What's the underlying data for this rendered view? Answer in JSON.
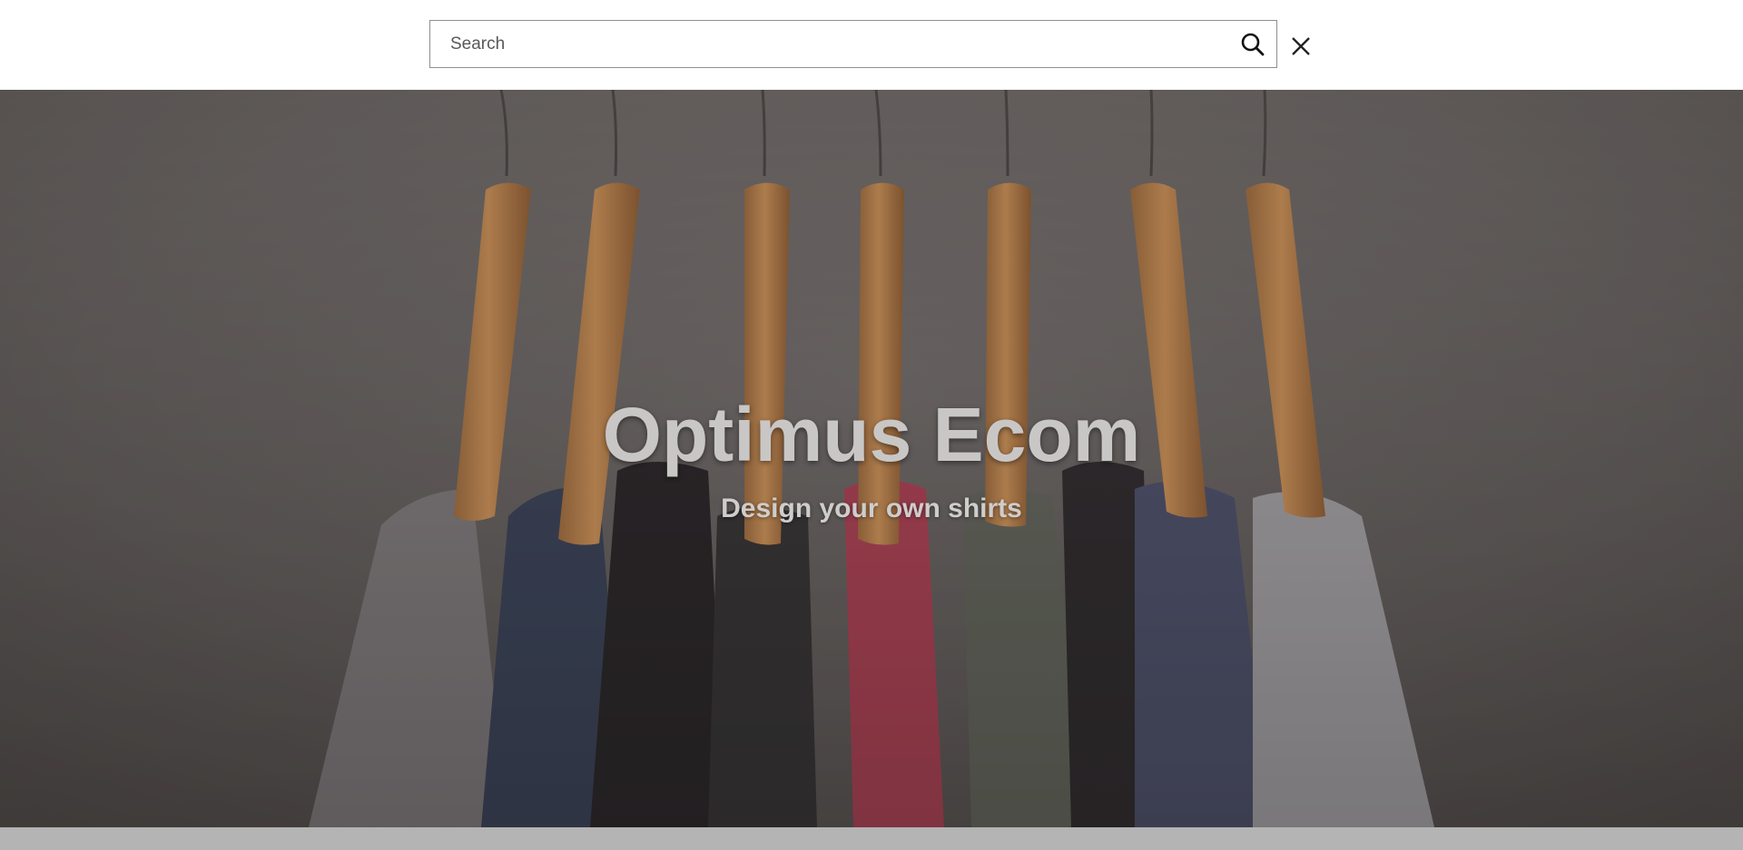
{
  "search": {
    "placeholder": "Search",
    "value": "",
    "submit_icon": "search-icon",
    "close_icon": "close-icon"
  },
  "hero": {
    "title": "Optimus Ecom",
    "subtitle": "Design your own shirts",
    "image": "clothes-on-hangers"
  },
  "colors": {
    "hero_text": "#c9c7c6",
    "search_border": "#8f8f8f",
    "bottom_strip": "#b4b4b4"
  }
}
